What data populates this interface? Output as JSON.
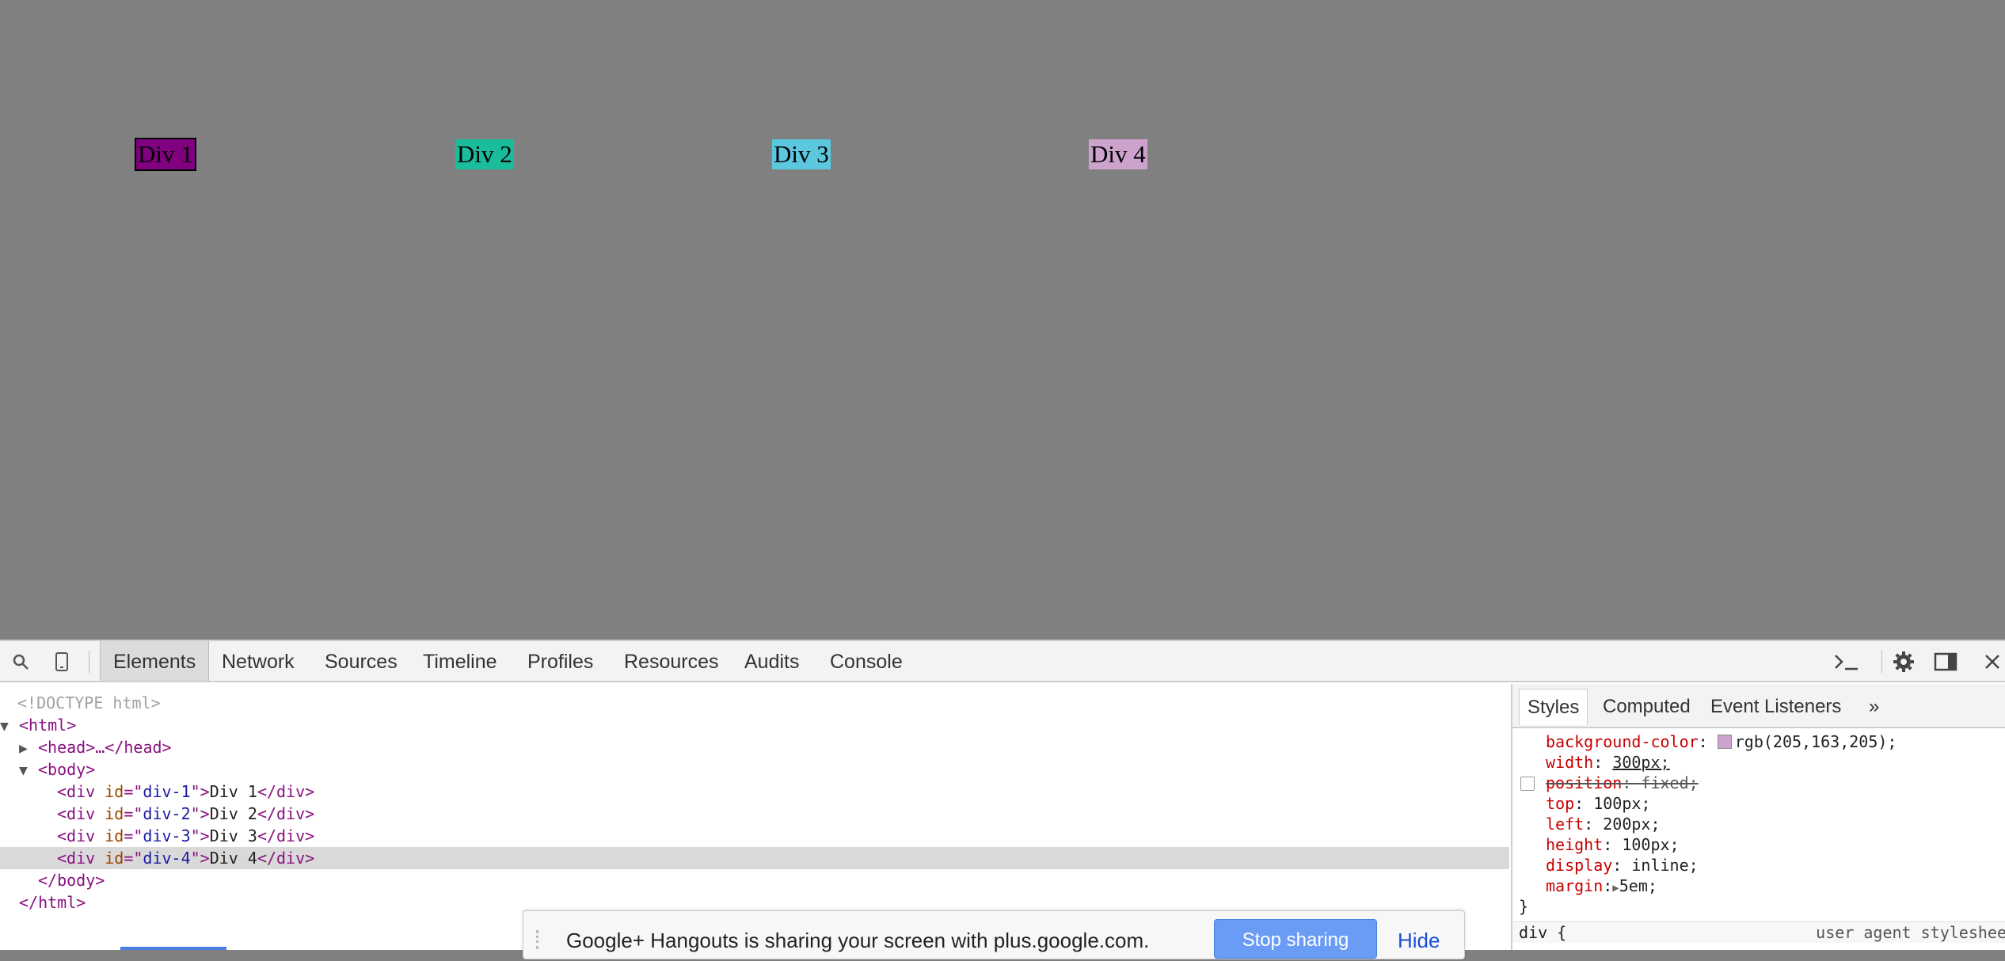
{
  "page": {
    "divs": [
      {
        "label": "Div 1",
        "color": "#800080"
      },
      {
        "label": "Div 2",
        "color": "#1abc9c"
      },
      {
        "label": "Div 3",
        "color": "#5bc8e0"
      },
      {
        "label": "Div 4",
        "color": "#cda3cd"
      }
    ]
  },
  "devtools": {
    "tabs": [
      "Elements",
      "Network",
      "Sources",
      "Timeline",
      "Profiles",
      "Resources",
      "Audits",
      "Console"
    ],
    "active_tab": "Elements",
    "icons": [
      "search-icon",
      "device-mode-icon",
      "console-drawer-icon",
      "settings-gear-icon",
      "dock-side-icon",
      "close-icon"
    ],
    "dom": {
      "doctype": "<!DOCTYPE html>",
      "html_open": "<html>",
      "head": "<head>…</head>",
      "body_open": "<body>",
      "divs": [
        {
          "id": "div-1",
          "text": "Div 1"
        },
        {
          "id": "div-2",
          "text": "Div 2"
        },
        {
          "id": "div-3",
          "text": "Div 3"
        },
        {
          "id": "div-4",
          "text": "Div 4"
        }
      ],
      "body_close": "</body>",
      "html_close": "</html>"
    },
    "styles_pane": {
      "tabs": [
        "Styles",
        "Computed",
        "Event Listeners",
        "»"
      ],
      "active_tab": "Styles",
      "rules": [
        {
          "prop": "background-color",
          "value": "rgb(205,163,205);",
          "swatch": "#cda3cd"
        },
        {
          "prop": "width",
          "value": "300px;"
        },
        {
          "prop": "position",
          "value": "fixed;",
          "disabled": true
        },
        {
          "prop": "top",
          "value": "100px;"
        },
        {
          "prop": "left",
          "value": "200px;"
        },
        {
          "prop": "height",
          "value": "100px;"
        },
        {
          "prop": "display",
          "value": "inline;"
        },
        {
          "prop": "margin",
          "value": "5em;"
        }
      ],
      "close_brace": "}",
      "next_selector": "div {",
      "next_origin": "user agent styleshee"
    }
  },
  "notification": {
    "message": "Google+ Hangouts is sharing your screen with plus.google.com.",
    "stop_label": "Stop sharing",
    "hide_label": "Hide"
  }
}
